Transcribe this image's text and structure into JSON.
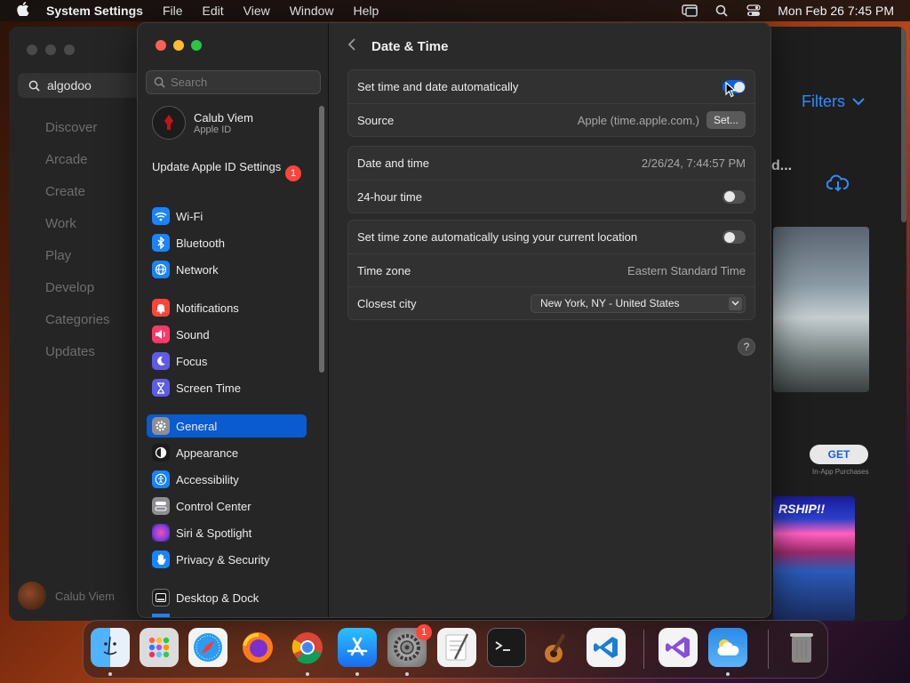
{
  "menubar": {
    "app_name": "System Settings",
    "menus": [
      "File",
      "Edit",
      "View",
      "Window",
      "Help"
    ],
    "clock": "Mon Feb 26  7:45 PM"
  },
  "appstore": {
    "search_value": "algodoo",
    "nav": [
      "Discover",
      "Arcade",
      "Create",
      "Work",
      "Play",
      "Develop",
      "Categories",
      "Updates"
    ],
    "user_name": "Calub Viem",
    "filters_label": "Filters",
    "partial_title": "d...",
    "get_label": "GET",
    "in_app_label": "In-App Purchases",
    "promo_text": "RSHIP!!"
  },
  "sidebar": {
    "search_placeholder": "Search",
    "account": {
      "name": "Calub Viem",
      "subtitle": "Apple ID"
    },
    "update": {
      "label": "Update Apple ID Settings",
      "badge": "1"
    },
    "items": [
      {
        "label": "Wi-Fi",
        "icon": "wifi-icon",
        "color": "#1a84ff"
      },
      {
        "label": "Bluetooth",
        "icon": "bluetooth-icon",
        "color": "#1a84ff"
      },
      {
        "label": "Network",
        "icon": "globe-icon",
        "color": "#1a84ff"
      },
      {
        "label": "Notifications",
        "icon": "bell-icon",
        "color": "#ff453a"
      },
      {
        "label": "Sound",
        "icon": "speaker-icon",
        "color": "#ff3a6a"
      },
      {
        "label": "Focus",
        "icon": "moon-icon",
        "color": "#5e5ce6"
      },
      {
        "label": "Screen Time",
        "icon": "hourglass-icon",
        "color": "#5e5ce6"
      },
      {
        "label": "General",
        "icon": "gear-icon",
        "color": "#8e8e93"
      },
      {
        "label": "Appearance",
        "icon": "appearance-icon",
        "color": "#1c1c1c"
      },
      {
        "label": "Accessibility",
        "icon": "accessibility-icon",
        "color": "#1a84ff"
      },
      {
        "label": "Control Center",
        "icon": "control-center-icon",
        "color": "#8e8e93"
      },
      {
        "label": "Siri & Spotlight",
        "icon": "siri-icon",
        "color": "#b04ad0"
      },
      {
        "label": "Privacy & Security",
        "icon": "hand-icon",
        "color": "#1a84ff"
      },
      {
        "label": "Desktop & Dock",
        "icon": "dock-icon",
        "color": "#1c1c1c"
      }
    ]
  },
  "content": {
    "title": "Date & Time",
    "auto_time": {
      "label": "Set time and date automatically",
      "on": true
    },
    "source": {
      "label": "Source",
      "value": "Apple (time.apple.com.)",
      "button": "Set..."
    },
    "date_time": {
      "label": "Date and time",
      "value": "2/26/24, 7:44:57 PM"
    },
    "hour24": {
      "label": "24-hour time",
      "on": false
    },
    "auto_tz": {
      "label": "Set time zone automatically using your current location",
      "on": false
    },
    "time_zone": {
      "label": "Time zone",
      "value": "Eastern Standard Time"
    },
    "closest_city": {
      "label": "Closest city",
      "value": "New York, NY - United States"
    },
    "help": "?"
  },
  "dock": {
    "apps": [
      "Finder",
      "Launchpad",
      "Safari",
      "Firefox",
      "Chrome",
      "App Store",
      "System Settings",
      "TextEdit",
      "Terminal",
      "GarageBand",
      "VS Code",
      "Visual Studio",
      "Weather",
      "Trash"
    ],
    "settings_badge": "1"
  }
}
